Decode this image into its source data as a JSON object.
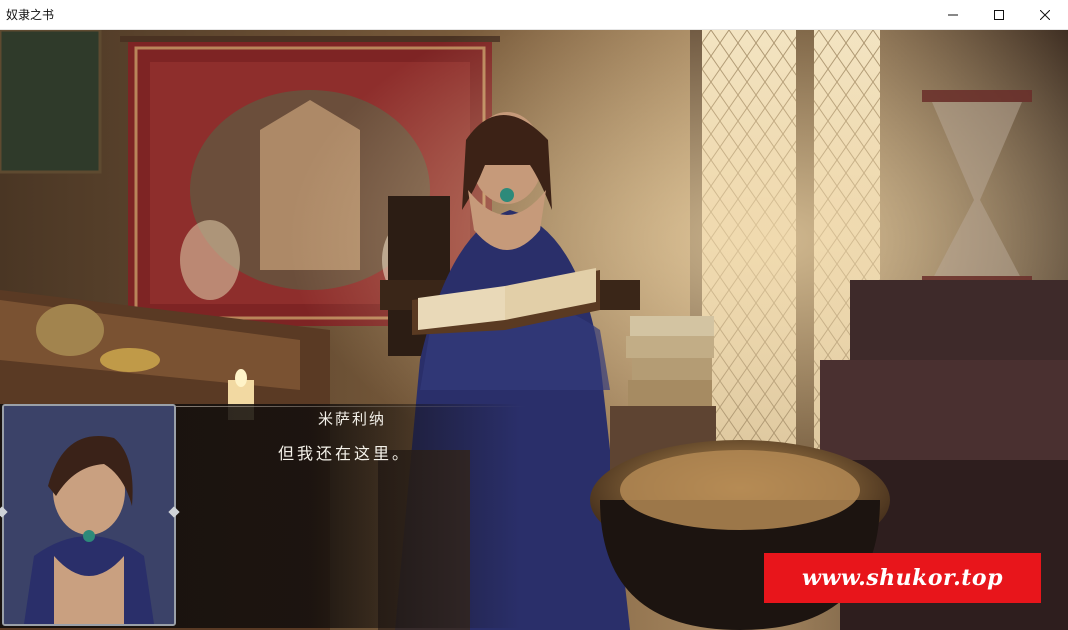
{
  "window": {
    "title": "奴隶之书",
    "controls": {
      "minimize_icon": "minimize-icon",
      "maximize_icon": "maximize-icon",
      "close_icon": "close-icon"
    }
  },
  "dialogue": {
    "speaker": "米萨利纳",
    "text": "但我还在这里。"
  },
  "watermark": {
    "text": "www.shukor.top",
    "color": "#e8151b"
  },
  "colors": {
    "scene_base": "#3a2a1c",
    "dress_blue": "#2a2f6a",
    "tapestry_red": "#8c2a2a"
  }
}
